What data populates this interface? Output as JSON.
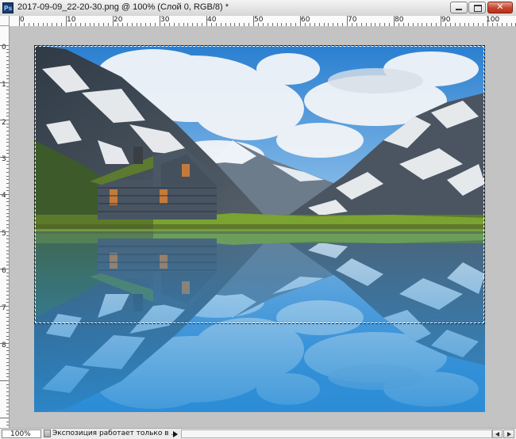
{
  "window": {
    "title": "2017-09-09_22-20-30.png @ 100% (Слой 0, RGB/8) *",
    "app_icon_label": "Ps",
    "close_glyph": "✕"
  },
  "rulers": {
    "top_labels": [
      "0",
      "10",
      "20",
      "30",
      "40",
      "50",
      "60",
      "70",
      "80",
      "90",
      "100"
    ],
    "left_labels": [
      "0",
      "1",
      "2",
      "3",
      "4",
      "5",
      "6",
      "7",
      "8"
    ]
  },
  "status": {
    "zoom": "100%",
    "message": "Экспозиция работает только в ..."
  },
  "colors": {
    "sky": "#3b8fd6",
    "cloud": "#f2f5f8",
    "water": "#2f8fd4",
    "grass": "#6f9a2e"
  }
}
